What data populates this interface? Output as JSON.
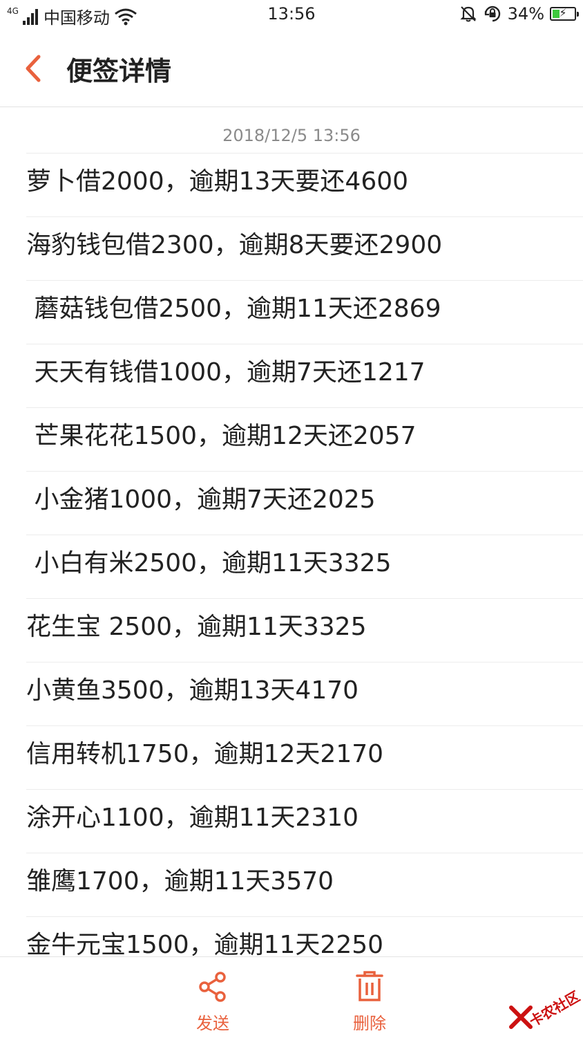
{
  "status_bar": {
    "network": "4G",
    "carrier": "中国移动",
    "time": "13:56",
    "battery_percent": "34%",
    "battery_level": 0.34,
    "icons": [
      "signal-icon",
      "wifi-icon",
      "mute-icon",
      "rotation-lock-icon",
      "battery-icon"
    ]
  },
  "header": {
    "title": "便签详情",
    "back_icon": "chevron-left-icon"
  },
  "note": {
    "timestamp": "2018/12/5 13:56",
    "lines": [
      "萝卜借2000，逾期13天要还4600",
      "海豹钱包借2300，逾期8天要还2900",
      " 蘑菇钱包借2500，逾期11天还2869",
      " 天天有钱借1000，逾期7天还1217",
      " 芒果花花1500，逾期12天还2057",
      " 小金猪1000，逾期7天还2025",
      " 小白有米2500，逾期11天3325",
      "花生宝 2500，逾期11天3325",
      "小黄鱼3500，逾期13天4170",
      "信用转机1750，逾期12天2170",
      "涂开心1100，逾期11天2310",
      "雏鹰1700，逾期11天3570",
      "金牛元宝1500，逾期11天2250"
    ]
  },
  "bottom_bar": {
    "send_label": "发送",
    "delete_label": "删除",
    "send_icon": "share-icon",
    "delete_icon": "trash-icon"
  },
  "watermark": {
    "text": "卡农社区"
  },
  "colors": {
    "accent": "#e9613d",
    "text": "#222222",
    "muted": "#8a8a8a",
    "divider": "#ececec",
    "battery_fill": "#3ec93e"
  }
}
